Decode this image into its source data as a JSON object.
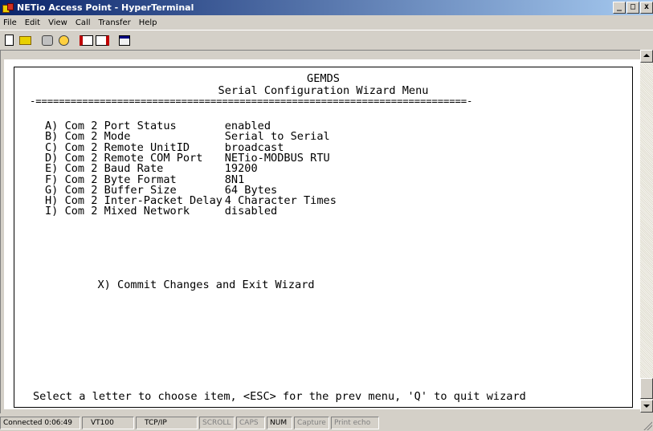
{
  "window": {
    "title": "NETio Access Point - HyperTerminal",
    "controls": [
      "_",
      "□",
      "x"
    ]
  },
  "menubar": [
    "File",
    "Edit",
    "View",
    "Call",
    "Transfer",
    "Help"
  ],
  "toolbar": {
    "icons": [
      "new-icon",
      "open-icon",
      "connect-icon",
      "disconnect-icon",
      "send-icon",
      "receive-icon",
      "properties-icon"
    ]
  },
  "terminal": {
    "header": "GEMDS",
    "menu_title": "Serial Configuration Wizard Menu",
    "separator": "-==========================================================================-",
    "items": [
      {
        "key": "A)",
        "label": "Com 2 Port Status",
        "value": "enabled"
      },
      {
        "key": "B)",
        "label": "Com 2 Mode",
        "value": "Serial to Serial"
      },
      {
        "key": "C)",
        "label": "Com 2 Remote UnitID",
        "value": "broadcast"
      },
      {
        "key": "D)",
        "label": "Com 2 Remote COM Port",
        "value": "NETio-MODBUS RTU"
      },
      {
        "key": "E)",
        "label": "Com 2 Baud Rate",
        "value": "19200"
      },
      {
        "key": "F)",
        "label": "Com 2 Byte Format",
        "value": "8N1"
      },
      {
        "key": "G)",
        "label": "Com 2 Buffer Size",
        "value": "64 Bytes"
      },
      {
        "key": "H)",
        "label": "Com 2 Inter-Packet Delay",
        "value": "4 Character Times"
      },
      {
        "key": "I)",
        "label": "Com 2 Mixed Network",
        "value": "disabled"
      }
    ],
    "commit": {
      "key": "X)",
      "label": "Commit Changes and Exit Wizard"
    },
    "prompt": "Select a letter to choose item, <ESC> for the prev menu, 'Q' to quit wizard"
  },
  "statusbar": {
    "connected": "Connected 0:06:49",
    "emulation": "VT100",
    "protocol": "TCP/IP",
    "scroll": "SCROLL",
    "caps": "CAPS",
    "num": "NUM",
    "capture": "Capture",
    "print_echo": "Print echo"
  }
}
